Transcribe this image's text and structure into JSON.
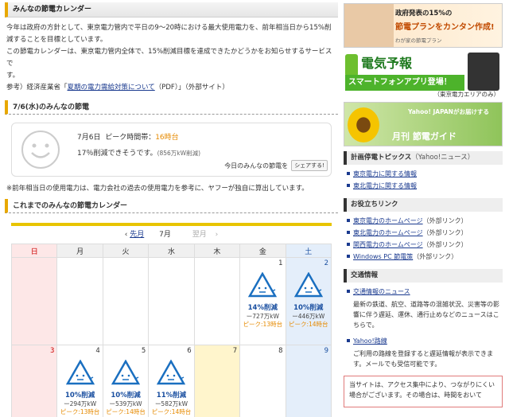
{
  "main": {
    "title": "みんなの節電カレンダー",
    "intro_lines": [
      "今年は政府の方針として、東京電力管内で平日の9〜20時における最大使用電力を、前年相当日から15%削",
      "減することを目標としています。",
      "この節電カレンダーは、東京電力管内全体で、15%削減目標を達成できたかどうかをお知らせするサービスで",
      "す。"
    ],
    "ref_prefix": "参考）経済産業省「",
    "ref_link": "夏期の電力需給対策について",
    "ref_suffix": "（PDF）」（外部サイト）"
  },
  "today": {
    "head": "7/6(水)のみんなの節電",
    "date": "7月6日",
    "peak_label": "ピーク時間帯：",
    "peak_value": "16時台",
    "rate": "17％削減できそうです。",
    "rate_detail": "(856万kW削減)",
    "share_label": "今日のみんなの節電を",
    "share_button": "シェアする!"
  },
  "note": "※前年相当日の使用電力は、電力会社の過去の使用電力を参考に、ヤフーが独自に算出しています。",
  "calendar": {
    "head": "これまでのみんなの節電カレンダー",
    "prev": "先月",
    "month": "7月",
    "next": "翌月",
    "weekdays": [
      "日",
      "月",
      "火",
      "水",
      "木",
      "金",
      "土"
    ],
    "days": [
      {
        "num": "1",
        "cut": "14%削減",
        "kw": "ー727万kW",
        "peak": "ピーク:13時台"
      },
      {
        "num": "2",
        "cut": "10%削減",
        "kw": "ー446万kW",
        "peak": "ピーク:14時台"
      },
      {
        "num": "3"
      },
      {
        "num": "4",
        "cut": "10%削減",
        "kw": "ー294万kW",
        "peak": "ピーク:13時台"
      },
      {
        "num": "5",
        "cut": "10%削減",
        "kw": "ー539万kW",
        "peak": "ピーク:14時台"
      },
      {
        "num": "6",
        "cut": "11%削減",
        "kw": "ー582万kW",
        "peak": "ピーク:14時台"
      },
      {
        "num": "7"
      },
      {
        "num": "8"
      },
      {
        "num": "9"
      }
    ]
  },
  "right": {
    "banner1": {
      "line1": "政府発表の15%の",
      "line2": "節電プランをカンタン作成!",
      "line3": "わが家の節電プラン"
    },
    "banner2": {
      "title": "電気予報",
      "bar": "スマートフォンアプリ登場！",
      "area": "（東京電力エリアのみ）"
    },
    "banner3": {
      "line1": "Yahoo! JAPANがお届けする",
      "line2": "月刊 節電ガイド"
    },
    "blackout": {
      "head": "計画停電トピックス",
      "sub": "（Yahoo!ニュース）",
      "items": [
        "東京電力に関する情報",
        "東北電力に関する情報"
      ]
    },
    "useful": {
      "head": "お役立ちリンク",
      "items": [
        {
          "label": "東京電力のホームページ",
          "ext": "（外部リンク）"
        },
        {
          "label": "東北電力のホームページ",
          "ext": "（外部リンク）"
        },
        {
          "label": "関西電力のホームページ",
          "ext": "（外部リンク）"
        },
        {
          "label": "Windows PC 節電策",
          "ext": "（外部リンク）"
        }
      ]
    },
    "traffic": {
      "head": "交通情報",
      "item1": "交通情報のニュース",
      "item1_text": "最新の鉄道、航空、道路等の混雑状況、災害等の影響に伴う遅延、運休、通行止めなどのニュースはこちらで。",
      "item2": "Yahoo!路線",
      "item2_text": "ご利用の路線を登録すると遅延情報が表示できます。メールでも受信可能です。"
    },
    "notice": "当サイトは、アクセス集中により、つながりにくい場合がございます。その場合は、時間をおいて"
  }
}
